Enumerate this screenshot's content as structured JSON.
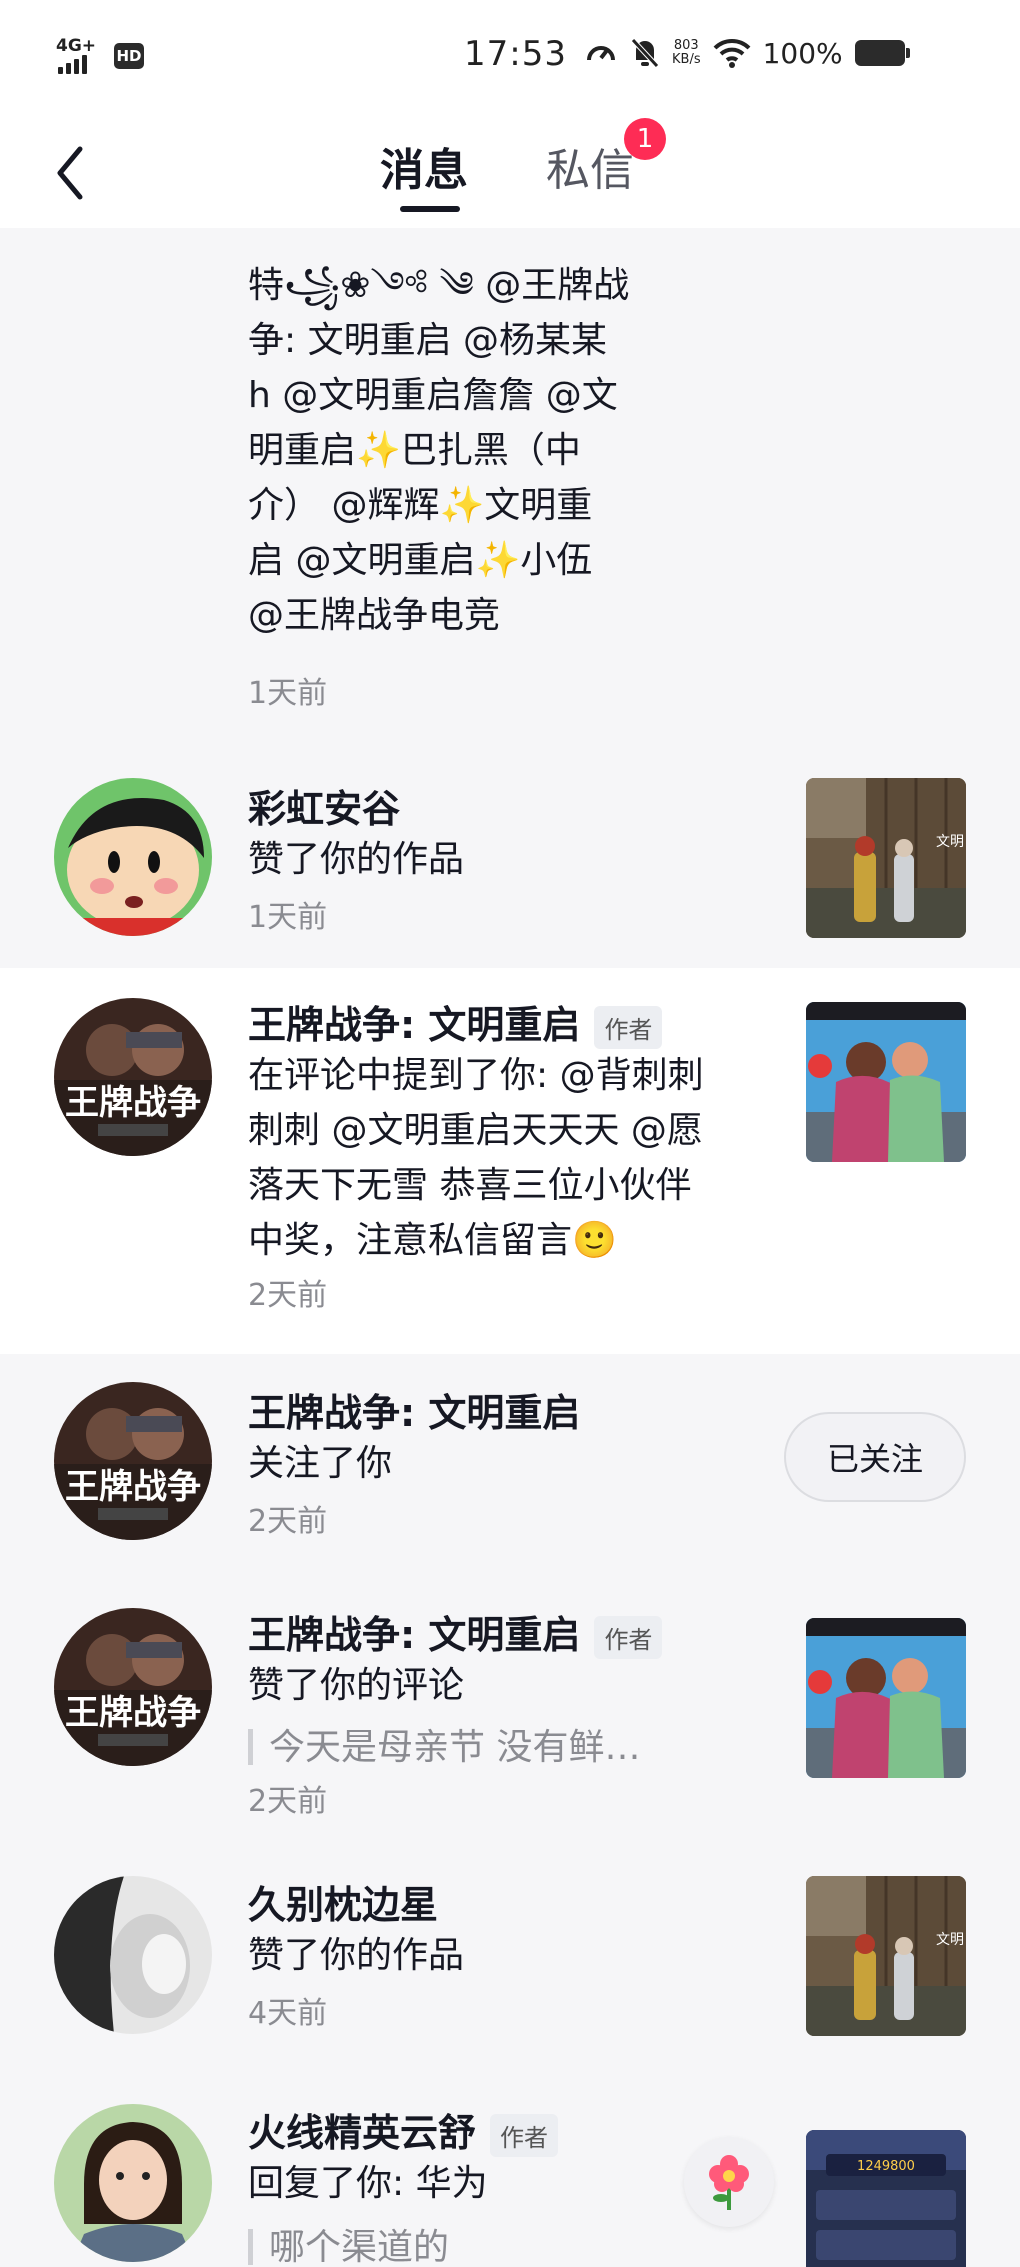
{
  "status_bar": {
    "network": "4G+",
    "hd": "HD",
    "time": "17:53",
    "speed_value": "803",
    "speed_unit": "KB/s",
    "battery": "100%"
  },
  "header": {
    "tabs": [
      "消息",
      "私信"
    ],
    "dm_badge": "1"
  },
  "feed": {
    "partial_top": {
      "lines": [
        "特꧁❀༺ ༄ @王牌战",
        "争: 文明重启 @杨某某",
        "h @文明重启詹詹 @文",
        "明重启✨巴扎黑（中",
        "介） @辉辉✨文明重",
        "启 @文明重启✨小伍",
        " @王牌战争电竞"
      ],
      "time": "1天前"
    },
    "items": [
      {
        "name": "彩虹安谷",
        "action": "赞了你的作品",
        "time": "1天前"
      },
      {
        "name": "王牌战争: 文明重启",
        "tag": "作者",
        "lines": [
          "在评论中提到了你: @背刺刺",
          "刺刺 @文明重启天天天 @愿",
          "落天下无雪 恭喜三位小伙伴",
          "中奖，注意私信留言🙂"
        ],
        "time": "2天前"
      },
      {
        "name": "王牌战争: 文明重启",
        "action": "关注了你",
        "time": "2天前",
        "button": "已关注"
      },
      {
        "name": "王牌战争: 文明重启",
        "tag": "作者",
        "action": "赞了你的评论",
        "quote": "今天是母亲节 没有鲜…",
        "time": "2天前"
      },
      {
        "name": "久别枕边星",
        "action": "赞了你的作品",
        "time": "4天前"
      },
      {
        "name": "火线精英云舒",
        "tag": "作者",
        "action": "回复了你: 华为",
        "quote": "哪个渠道的"
      }
    ]
  },
  "avatar_text": {
    "game_logo": "王牌战争"
  },
  "thumb_text": {
    "thumb_game_label": "文明",
    "thumb_score": "1249800"
  },
  "colors": {
    "accent": "#fe2c55",
    "secondary_text": "#8a8b91",
    "background": "#f6f6f8"
  }
}
